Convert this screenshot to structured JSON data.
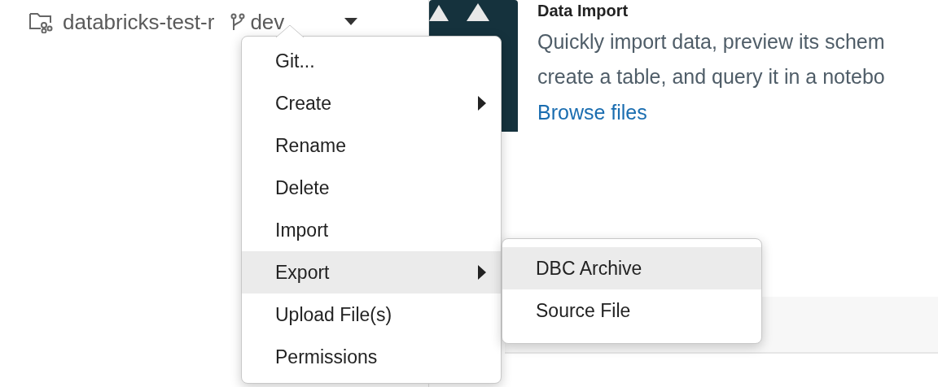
{
  "repo": {
    "name": "databricks-test-r",
    "branch": "dev"
  },
  "card": {
    "title": "Data Import",
    "description": "Quickly import data, preview its schem",
    "description_line_2": "create a table, and query it in a notebo",
    "link": "Browse files"
  },
  "menu": {
    "items": [
      {
        "label": "Git...",
        "has_submenu": false,
        "selected": false
      },
      {
        "label": "Create",
        "has_submenu": true,
        "selected": false
      },
      {
        "label": "Rename",
        "has_submenu": false,
        "selected": false
      },
      {
        "label": "Delete",
        "has_submenu": false,
        "selected": false
      },
      {
        "label": "Import",
        "has_submenu": false,
        "selected": false
      },
      {
        "label": "Export",
        "has_submenu": true,
        "selected": true
      },
      {
        "label": "Upload File(s)",
        "has_submenu": false,
        "selected": false
      },
      {
        "label": "Permissions",
        "has_submenu": false,
        "selected": false
      }
    ]
  },
  "submenu": {
    "items": [
      {
        "label": "DBC Archive",
        "selected": true
      },
      {
        "label": "Source File",
        "selected": false
      }
    ]
  }
}
